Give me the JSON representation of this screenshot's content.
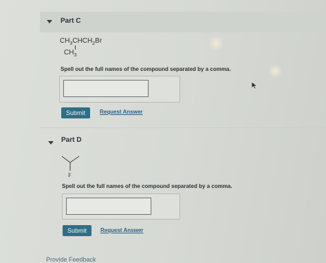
{
  "part_c": {
    "title": "Part C",
    "formula_main": "CH3CHCH2Br",
    "formula_branch": "CH3",
    "prompt": "Spell out the full names of the compound separated by a comma.",
    "answer_value": "",
    "submit_label": "Submit",
    "request_answer_label": "Request Answer"
  },
  "part_d": {
    "title": "Part D",
    "structure_atom": "F",
    "prompt": "Spell out the full names of the compound separated by a comma.",
    "answer_value": "",
    "submit_label": "Submit",
    "request_answer_label": "Request Answer"
  },
  "footer": {
    "provide_feedback_label": "Provide Feedback"
  },
  "colors": {
    "submit_button": "#2f6f86",
    "link": "#2c5f86"
  }
}
